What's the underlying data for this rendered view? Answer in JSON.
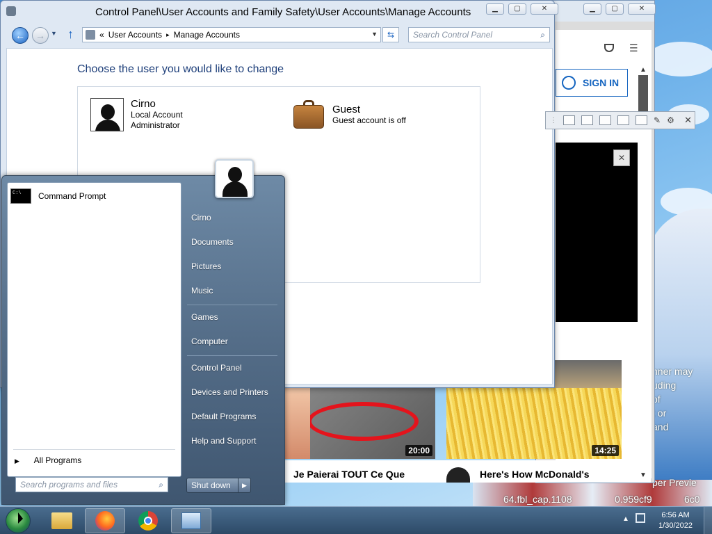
{
  "control_panel": {
    "title": "Control Panel\\User Accounts and Family Safety\\User Accounts\\Manage Accounts",
    "breadcrumb": {
      "prefix": "«",
      "crumb1": "User Accounts",
      "separator": "▸",
      "crumb2": "Manage Accounts"
    },
    "search_placeholder": "Search Control Panel",
    "heading": "Choose the user you would like to change",
    "accounts": [
      {
        "name": "Cirno",
        "line1": "Local Account",
        "line2": "Administrator"
      },
      {
        "name": "Guest",
        "line1": "Guest account is off"
      }
    ]
  },
  "browser": {
    "sign_in": "SIGN IN",
    "videos": [
      {
        "title": "Je Paierai TOUT Ce Que",
        "duration": "20:00"
      },
      {
        "title": "Here's How McDonald's",
        "duration": "14:25"
      }
    ]
  },
  "start_menu": {
    "pinned": [
      {
        "label": "Command Prompt"
      }
    ],
    "all_programs": "All Programs",
    "search_placeholder": "Search programs and files",
    "right_items": [
      "Cirno",
      "Documents",
      "Pictures",
      "Music",
      "Games",
      "Computer",
      "Control Panel",
      "Devices and Printers",
      "Default Programs",
      "Help and Support"
    ],
    "shutdown": "Shut down"
  },
  "desktop_text": {
    "lines": [
      "nner may",
      "uding",
      "of",
      "t or",
      "and",
      "per Previe",
      "64.fbl_cap.1108",
      "0.959cf9",
      "6c0"
    ]
  },
  "taskbar": {
    "time": "6:56 AM",
    "date": "1/30/2022"
  },
  "colors": {
    "accent": "#1e3f7a",
    "start_menu": "#546d88",
    "taskbar": "#2d4a67",
    "sign_in": "#1565c0"
  }
}
